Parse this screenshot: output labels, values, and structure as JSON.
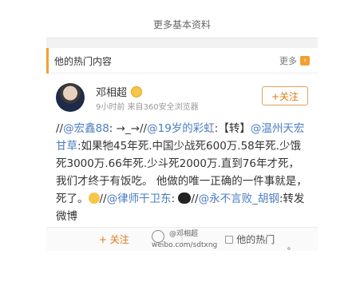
{
  "more_profile": "更多基本资料",
  "hot_section": {
    "title": "他的热门内容",
    "more_label": "更多",
    "more_icon": "chevron-right-icon"
  },
  "user": {
    "name": "邓相超",
    "meta": "9小时前  来自360安全浏览器",
    "follow_label": "+关注"
  },
  "post": {
    "segments": [
      "//",
      "@宏鑫88",
      ": →_→//",
      "@19岁的彩虹",
      ":【转】",
      "@温州天宏甘草",
      ":如果牠45年死.中国少战死600万.58年死.少饿死3000万.66年死.少斗死2000万.直到76年才死，我们才终于有饭吃。 他做的唯一正确的一件事就是，死了。",
      "//",
      "@律师干卫东",
      ":",
      "//",
      "@永不言败_胡钢",
      ":转发微博"
    ]
  },
  "actions": {
    "follow": "+ 关注",
    "hot": "他的热门"
  },
  "watermark": {
    "line1": "@邓相超",
    "line2": "weibo.com/sdtxng"
  },
  "corner_mark": "。"
}
